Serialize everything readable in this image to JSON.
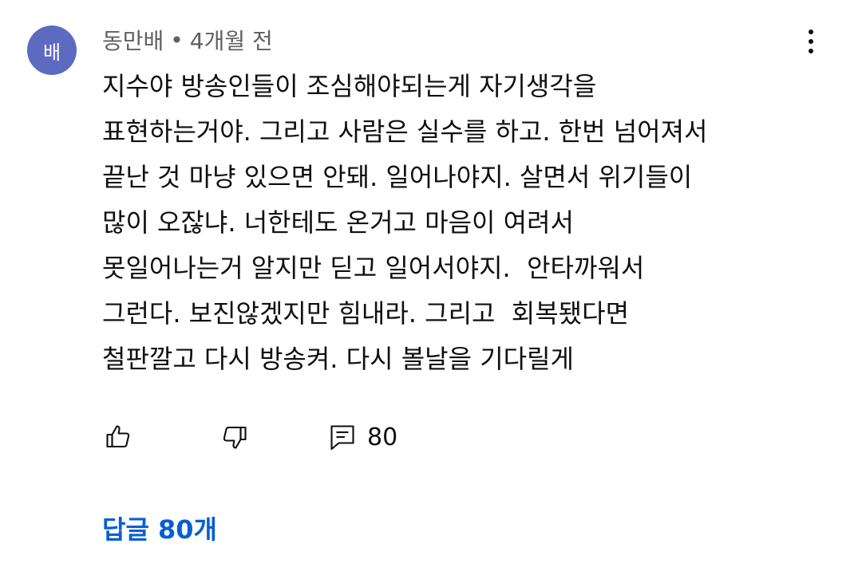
{
  "comment": {
    "avatar_letter": "배",
    "avatar_color": "#5c6bc0",
    "author": "동만배",
    "separator": "•",
    "time": "4개월 전",
    "lines": [
      "지수야 방송인들이 조심해야되는게 자기생각을",
      "표현하는거야. 그리고 사람은 실수를 하고. 한번 넘어져서",
      "끝난 것 마냥 있으면 안돼. 일어나야지. 살면서 위기들이",
      "많이 오잖냐. 너한테도 온거고 마음이 여려서",
      "못일어나는거 알지만 딛고 일어서야지.  안타까워서",
      "그런다. 보진않겠지만 힘내라. 그리고  회복됐다면",
      "철판깔고 다시 방송켜. 다시 볼날을 기다릴게"
    ],
    "actions": {
      "like_icon": "thumbs-up-icon",
      "dislike_icon": "thumbs-down-icon",
      "reply_icon": "comment-icon",
      "reply_count": "80"
    },
    "replies_label": "답글 80개",
    "link_color": "#065fd4"
  }
}
